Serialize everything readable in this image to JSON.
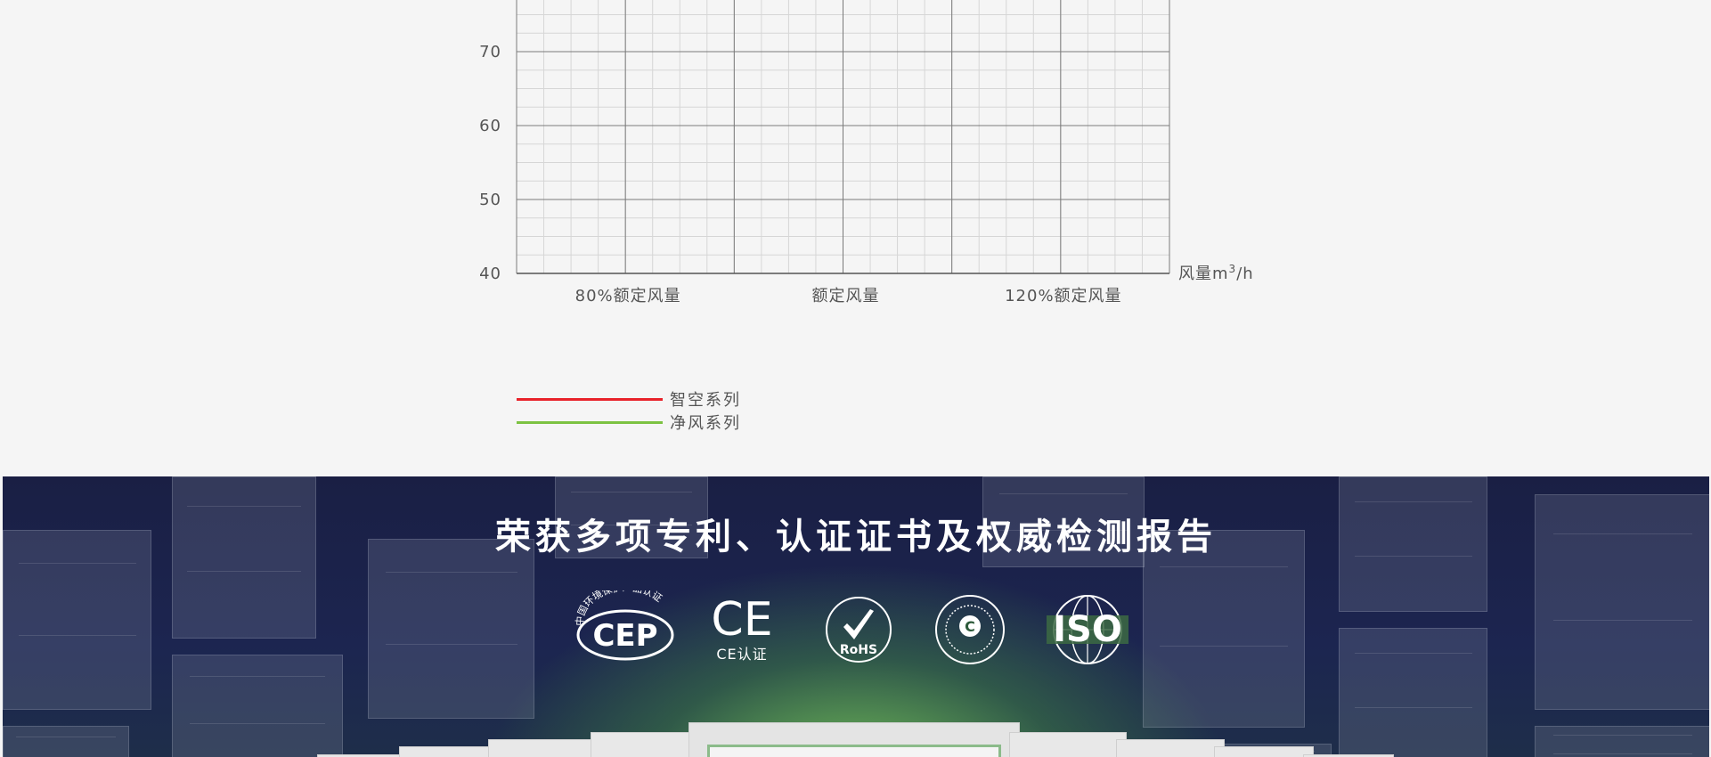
{
  "chart_data": {
    "type": "line",
    "yticks": [
      "70",
      "60",
      "50",
      "40"
    ],
    "ytick_values": [
      70,
      60,
      50,
      40
    ],
    "ylim": [
      40,
      77
    ],
    "x_categories": [
      "80%额定风量",
      "额定风量",
      "120%额定风量"
    ],
    "xlabel_prefix": "风量m",
    "xlabel_sup": "3",
    "xlabel_suffix": "/h",
    "grid": true,
    "series": [
      {
        "name": "智空系列",
        "color": "#e8222a",
        "values": []
      },
      {
        "name": "净风系列",
        "color": "#7cc242",
        "values": []
      }
    ]
  },
  "certifications": {
    "title": "荣获多项专利、认证证书及权威检测报告",
    "logos": [
      {
        "icon": "cep-logo",
        "arc_text": "中国环境保护产品认证",
        "main_text": "CEP"
      },
      {
        "icon": "ce-logo",
        "main_text": "CE",
        "caption": "CE认证"
      },
      {
        "icon": "rohs-logo",
        "main_text": "RoHS"
      },
      {
        "icon": "china-certification-seal-logo",
        "main_text": "C"
      },
      {
        "icon": "iso-logo",
        "main_text": "ISO"
      }
    ]
  }
}
